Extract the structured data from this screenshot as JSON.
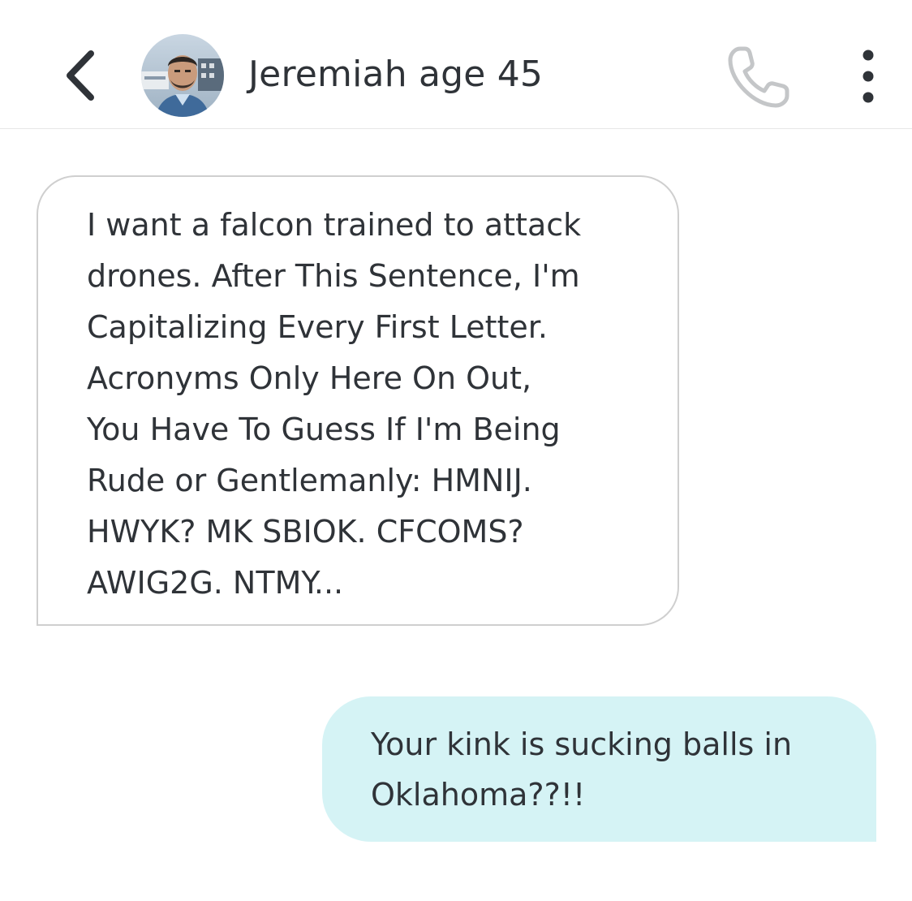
{
  "header": {
    "contact_name": "Jeremiah age 45",
    "back_icon": "chevron-left-icon",
    "call_icon": "phone-icon",
    "more_icon": "more-vertical-icon"
  },
  "messages": [
    {
      "direction": "incoming",
      "text": "I want a falcon trained to attack\ndrones. After This Sentence, I'm\nCapitalizing Every First Letter.\nAcronyms Only Here On Out,\nYou Have To Guess If I'm Being\nRude or Gentlemanly: HMNIJ.\nHWYK? MK SBIOK. CFCOMS?\nAWIG2G. NTMY..."
    },
    {
      "direction": "outgoing",
      "text": "Your kink is sucking balls in\nOklahoma??!!"
    }
  ],
  "colors": {
    "outgoing_bubble": "#d5f3f5",
    "incoming_border": "#cfcfcf",
    "text": "#2f3338",
    "icon_gray": "#c4c6c8"
  }
}
